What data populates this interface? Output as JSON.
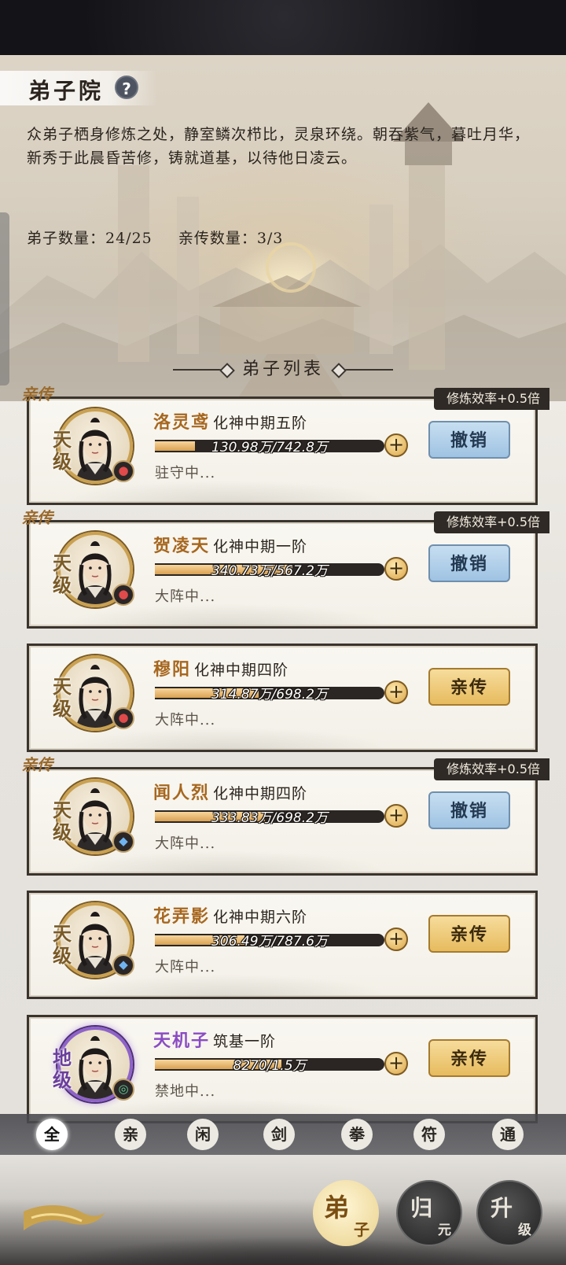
{
  "page": {
    "title": "弟子院",
    "description": "众弟子栖身修炼之处，静室鳞次栉比，灵泉环绕。朝吞紫气，暮吐月华，新秀于此晨昏苦修，铸就道基，以待他日凌云。",
    "disciple_count": "弟子数量：24/25",
    "direct_count": "亲传数量：3/3",
    "list_title": "弟子列表"
  },
  "disciples": [
    {
      "tag": "亲传",
      "efficiency": "修炼效率+0.5倍",
      "grade": "天级",
      "name": "洛灵鸢",
      "realm": "化神中期五阶",
      "progress_text": "130.98万/742.8万",
      "progress": 0.176,
      "status": "驻守中...",
      "action": "撤销",
      "element": "fire"
    },
    {
      "tag": "亲传",
      "efficiency": "修炼效率+0.5倍",
      "grade": "天级",
      "name": "贺凌天",
      "realm": "化神中期一阶",
      "progress_text": "340.73万/567.2万",
      "progress": 0.601,
      "status": "大阵中...",
      "action": "撤销",
      "element": "fire"
    },
    {
      "tag": "",
      "efficiency": "",
      "grade": "天级",
      "name": "穆阳",
      "realm": "化神中期四阶",
      "progress_text": "314.87万/698.2万",
      "progress": 0.451,
      "status": "大阵中...",
      "action": "亲传",
      "element": "fire"
    },
    {
      "tag": "亲传",
      "efficiency": "修炼效率+0.5倍",
      "grade": "天级",
      "name": "闻人烈",
      "realm": "化神中期四阶",
      "progress_text": "333.83万/698.2万",
      "progress": 0.478,
      "status": "大阵中...",
      "action": "撤销",
      "element": "water"
    },
    {
      "tag": "",
      "efficiency": "",
      "grade": "天级",
      "name": "花弄影",
      "realm": "化神中期六阶",
      "progress_text": "306.49万/787.6万",
      "progress": 0.389,
      "status": "大阵中...",
      "action": "亲传",
      "element": "water"
    },
    {
      "tag": "",
      "efficiency": "",
      "grade": "地级",
      "name": "天机子",
      "realm": "筑基一阶",
      "progress_text": "8270/1.5万",
      "progress": 0.551,
      "status": "禁地中...",
      "action": "亲传",
      "element": "wind"
    }
  ],
  "filters": [
    "全",
    "亲",
    "闲",
    "剑",
    "拳",
    "符",
    "通"
  ],
  "nav": [
    {
      "big": "弟",
      "small": "子"
    },
    {
      "big": "归",
      "small": "元"
    },
    {
      "big": "升",
      "small": "级"
    }
  ],
  "colors": {
    "gold": "#a7671f",
    "purple": "#8a4cc4",
    "revoke_blue": "#9fc3e3",
    "promote_gold": "#e7bb5e"
  }
}
